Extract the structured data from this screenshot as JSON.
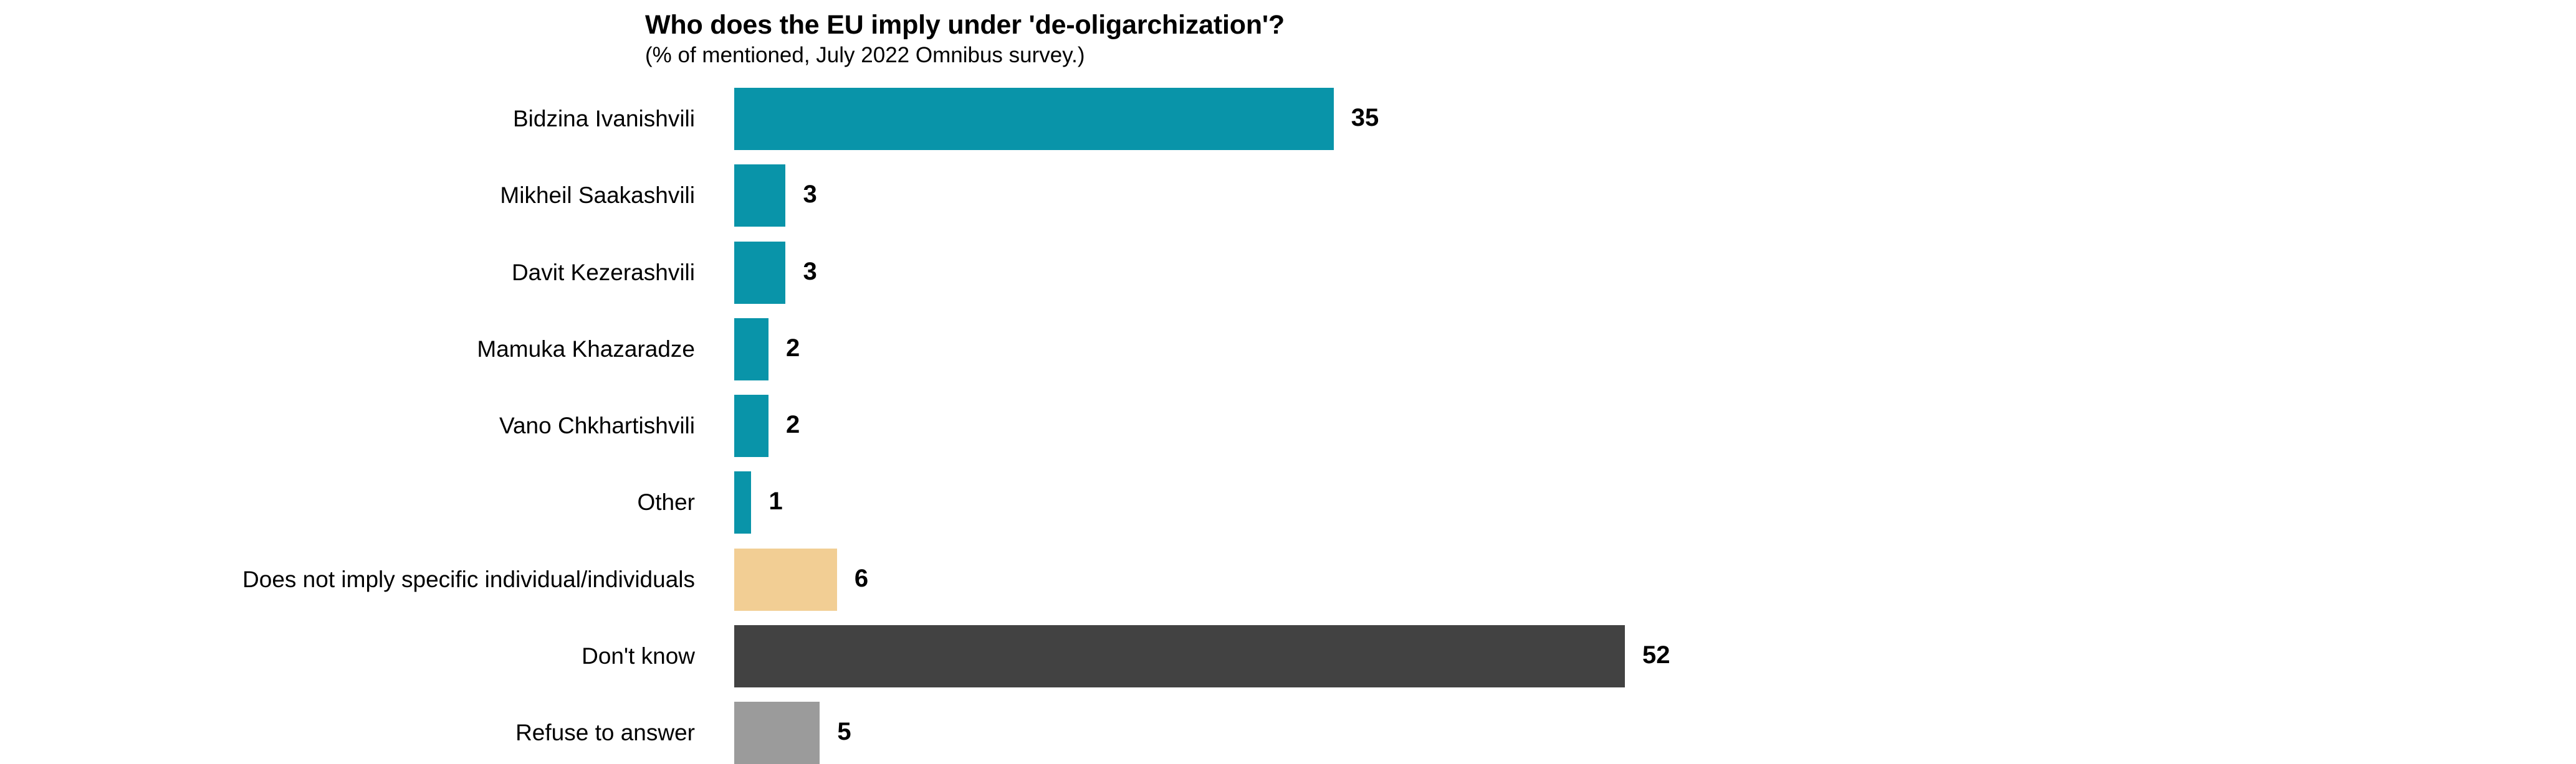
{
  "chart_data": {
    "type": "bar",
    "orientation": "horizontal",
    "title": "Who does the EU imply under 'de-oligarchization'?",
    "subtitle": "(% of mentioned, July 2022 Omnibus survey.)",
    "xlabel": "",
    "ylabel": "",
    "xlim": [
      0,
      52
    ],
    "grid": false,
    "legend": "none",
    "unit": "%",
    "categories": [
      "Bidzina Ivanishvili",
      "Mikheil Saakashvili",
      "Davit Kezerashvili",
      "Mamuka Khazaradze",
      "Vano Chkhartishvili",
      "Other",
      "Does not imply specific individual/individuals",
      "Don't know",
      "Refuse to answer"
    ],
    "values": [
      35,
      3,
      3,
      2,
      2,
      1,
      6,
      52,
      5
    ],
    "value_labels": [
      "35",
      "3",
      "3",
      "2",
      "2",
      "1",
      "6",
      "52",
      "5"
    ],
    "bar_colors": [
      "#0994a9",
      "#0994a9",
      "#0994a9",
      "#0994a9",
      "#0994a9",
      "#0994a9",
      "#f2ce94",
      "#424242",
      "#9b9b9b"
    ],
    "palette": {
      "teal": "#0994a9",
      "tan": "#f2ce94",
      "dark_gray": "#424242",
      "light_gray": "#9b9b9b",
      "background": "#ffffff",
      "text": "#000000"
    }
  }
}
